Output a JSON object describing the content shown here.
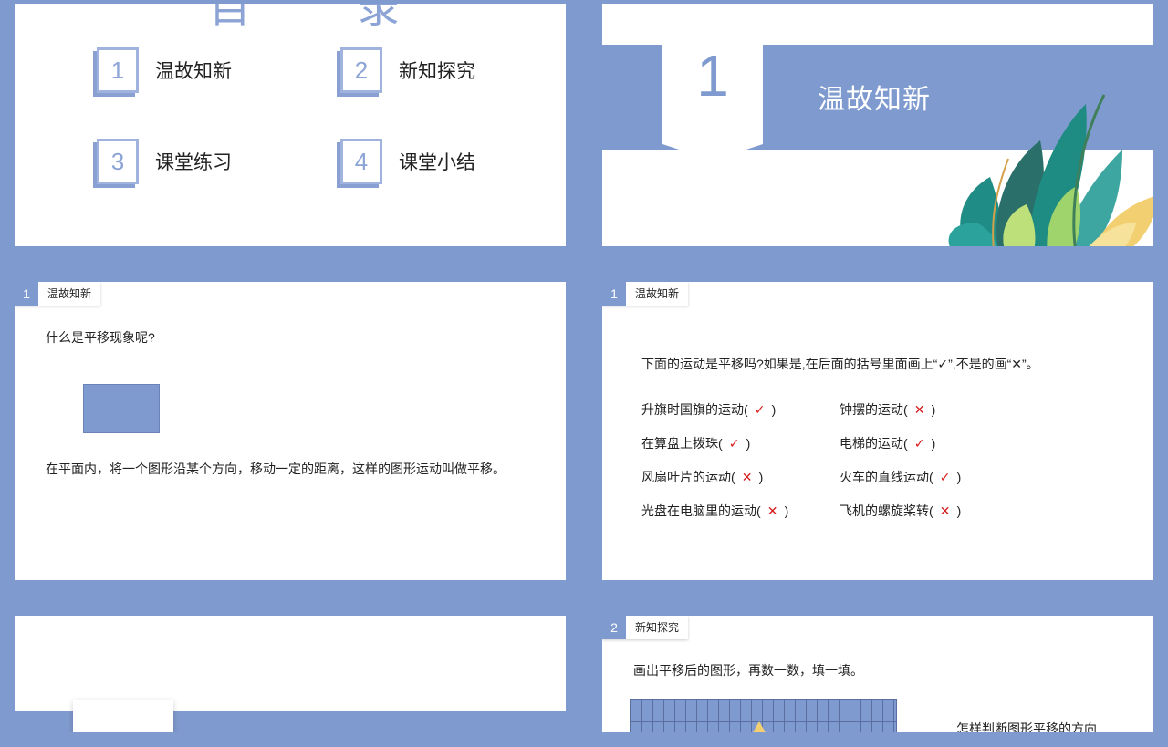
{
  "toc": {
    "title": "目 录",
    "items": [
      {
        "num": "1",
        "label": "温故知新"
      },
      {
        "num": "2",
        "label": "新知探究"
      },
      {
        "num": "3",
        "label": "课堂练习"
      },
      {
        "num": "4",
        "label": "课堂小结"
      }
    ]
  },
  "section1": {
    "num": "1",
    "title": "温故知新"
  },
  "slide3": {
    "tag_num": "1",
    "tag_label": "温故知新",
    "question": "什么是平移现象呢?",
    "definition": "在平面内，将一个图形沿某个方向，移动一定的距离，这样的图形运动叫做平移。"
  },
  "slide4": {
    "tag_num": "1",
    "tag_label": "温故知新",
    "instruction": "下面的运动是平移吗?如果是,在后面的括号里面画上“✓”,不是的画“✕”。",
    "left": [
      {
        "text": "升旗时国旗的运动(",
        "mark": "✓",
        "close": ")"
      },
      {
        "text": "在算盘上拨珠(",
        "mark": "✓",
        "close": ")"
      },
      {
        "text": "风扇叶片的运动(",
        "mark": "✕",
        "close": ")"
      },
      {
        "text": "光盘在电脑里的运动(",
        "mark": "✕",
        "close": ")"
      }
    ],
    "right": [
      {
        "text": "钟摆的运动(",
        "mark": "✕",
        "close": ")"
      },
      {
        "text": "电梯的运动(",
        "mark": "✓",
        "close": ")"
      },
      {
        "text": "火车的直线运动(",
        "mark": "✓",
        "close": ")"
      },
      {
        "text": "飞机的螺旋桨转(",
        "mark": "✕",
        "close": ")"
      }
    ]
  },
  "slide6": {
    "tag_num": "2",
    "tag_label": "新知探究",
    "instruction": "画出平移后的图形，再数一数，填一填。",
    "side_text": "怎样判断图形平移的方向"
  },
  "colors": {
    "accent": "#7f9ace",
    "mark": "#d71b1b"
  }
}
